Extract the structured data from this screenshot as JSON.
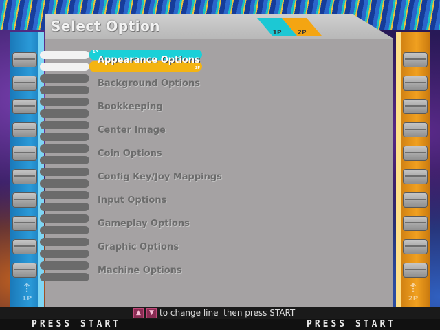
{
  "header": {
    "title": "Select Option",
    "tab_1p": "1P",
    "tab_2p": "2P"
  },
  "menu": {
    "selected_index": 0,
    "highlight_1p": "1P",
    "highlight_2p": "2P",
    "items": [
      "Appearance Options",
      "Background Options",
      "Bookkeeping",
      "Center Image",
      "Coin Options",
      "Config Key/Joy Mappings",
      "Input Options",
      "Gameplay Options",
      "Graphic Options",
      "Machine Options"
    ]
  },
  "side": {
    "left_badge": "1P",
    "right_badge": "2P"
  },
  "footer": {
    "hint_text": "to change line  then press START",
    "press_start_left": "PRESS START",
    "press_start_right": "PRESS START"
  },
  "colors": {
    "player1": "#1ad0d8",
    "player2": "#f4b412",
    "panel": "#a5a2a3"
  }
}
